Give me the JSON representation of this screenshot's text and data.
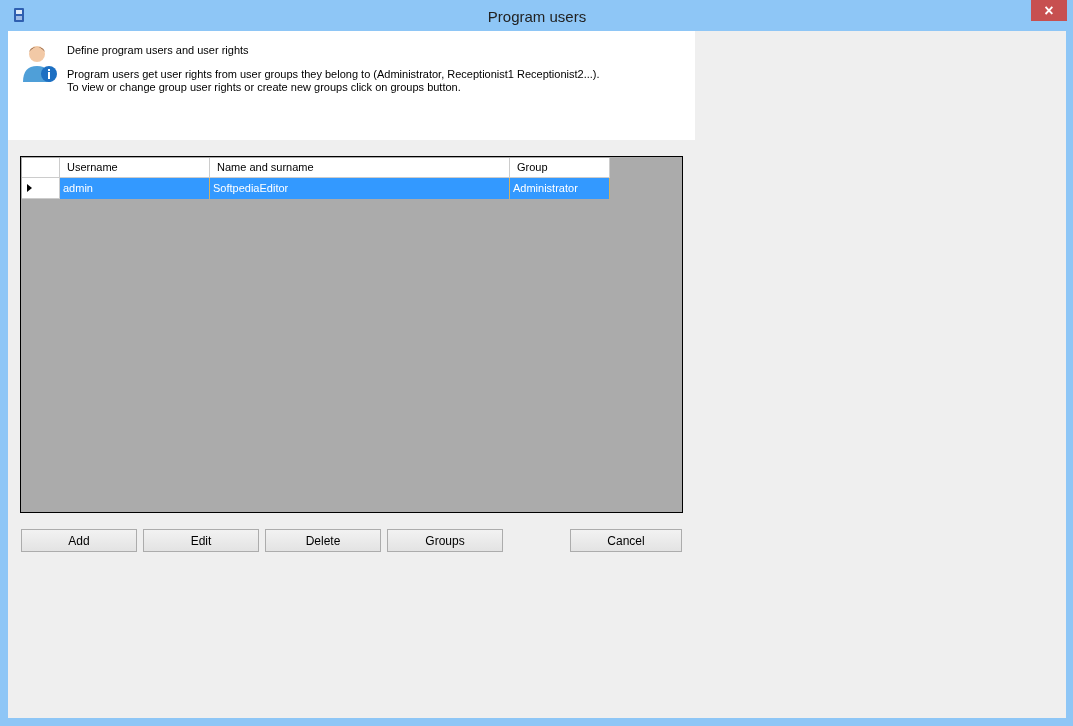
{
  "window": {
    "title": "Program users",
    "close": "×"
  },
  "header": {
    "title": "Define program users and user rights",
    "lines": [
      "Program users get user rights from user groups they belong to (Administrator, Receptionist1 Receptionist2...).",
      "To view or change group user rights or create new groups click on groups button."
    ]
  },
  "table": {
    "columns": [
      "Username",
      "Name and surname",
      "Group"
    ],
    "rows": [
      {
        "cells": [
          "admin",
          "SoftpediaEditor",
          "Administrator"
        ],
        "selected": true
      }
    ]
  },
  "buttons": [
    "Add",
    "Edit",
    "Delete",
    "Groups"
  ],
  "cancel_button": "Cancel"
}
